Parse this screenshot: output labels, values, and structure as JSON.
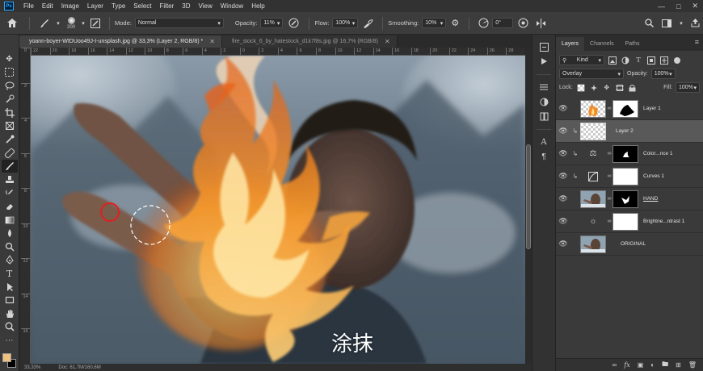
{
  "app": {
    "logo": "Ps"
  },
  "menu": [
    "File",
    "Edit",
    "Image",
    "Layer",
    "Type",
    "Select",
    "Filter",
    "3D",
    "View",
    "Window",
    "Help"
  ],
  "options": {
    "brush_size": "200",
    "mode_label": "Mode:",
    "mode_value": "Normal",
    "opacity_label": "Opacity:",
    "opacity_value": "11%",
    "flow_label": "Flow:",
    "flow_value": "100%",
    "smoothing_label": "Smoothing:",
    "smoothing_value": "10%",
    "angle_value": "0°"
  },
  "tabs": [
    {
      "label": "yoann-boyer-WIDUoo49J-I-unsplash.jpg @ 33,3% (Layer 2, RGB/8) *",
      "active": true
    },
    {
      "label": "fire_stock_6_by_hatestock_d1k7f8s.jpg @ 16,7% (RGB/8)",
      "active": false
    }
  ],
  "ruler_top": [
    "22",
    "20",
    "18",
    "16",
    "14",
    "12",
    "10",
    "8",
    "6",
    "4",
    "2",
    "0",
    "2",
    "4",
    "6",
    "8",
    "10",
    "12",
    "14",
    "16",
    "18",
    "20",
    "22",
    "24",
    "26",
    "28"
  ],
  "ruler_left": [
    "0",
    "2",
    "4",
    "6",
    "8",
    "10",
    "12",
    "14",
    "16"
  ],
  "canvas": {
    "subtitle": "涂抹"
  },
  "status": {
    "zoom": "33,33%",
    "doc": "Doc: 61,7M/160,6M"
  },
  "panel": {
    "tabs": [
      "Layers",
      "Channels",
      "Paths"
    ],
    "active_tab": "Layers",
    "kind_label": "Kind",
    "blend_mode": "Overlay",
    "opacity_label": "Opacity:",
    "opacity_value": "100%",
    "lock_label": "Lock:",
    "fill_label": "Fill:",
    "fill_value": "100%"
  },
  "layers": [
    {
      "name": "Layer 1",
      "selected": false
    },
    {
      "name": "Layer 2",
      "selected": true
    },
    {
      "name": "Color...nce 1",
      "selected": false
    },
    {
      "name": "Curves 1",
      "selected": false
    },
    {
      "name": "HAND",
      "selected": false
    },
    {
      "name": "Brightne...ntrast 1",
      "selected": false
    },
    {
      "name": "ORIGINAL",
      "selected": false
    }
  ],
  "colors": {
    "foreground": "#f1c27d",
    "background": "#000000",
    "accent": "#31a8ff"
  }
}
